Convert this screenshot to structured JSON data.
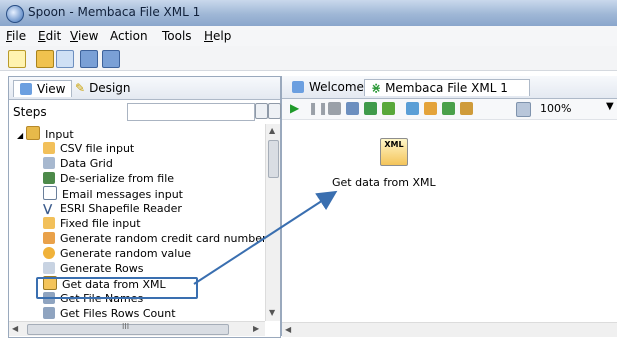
{
  "window": {
    "title": "Spoon - Membaca File XML 1"
  },
  "menu": {
    "items": [
      "File",
      "Edit",
      "View",
      "Action",
      "Tools",
      "Help"
    ],
    "underlined": [
      "F",
      "E",
      "V",
      "",
      "",
      "H"
    ]
  },
  "left_panel": {
    "tabs": {
      "view": "View",
      "design": "Design"
    },
    "steps_label": "Steps",
    "search": {
      "value": "",
      "placeholder": ""
    },
    "tree": {
      "category": "Input",
      "items": [
        "CSV file input",
        "Data Grid",
        "De-serialize from file",
        "Email messages input",
        "ESRI Shapefile Reader",
        "Fixed file input",
        "Generate random credit card numbers",
        "Generate random value",
        "Generate Rows",
        "Get data from XML",
        "Get File Names",
        "Get Files Rows Count"
      ],
      "selected": "Get data from XML"
    },
    "scrollbar": {
      "h_thumb_label": "III"
    }
  },
  "right_panel": {
    "tabs": {
      "welcome": "Welcome!",
      "active": "Membaca File XML 1",
      "close_glyph": "✕"
    },
    "zoom": "100%",
    "canvas": {
      "step_label": "Get data from XML",
      "step_icon_text": "XML"
    }
  },
  "colors": {
    "accent": "#3a6fb0",
    "titlebar": "#9fb7d6",
    "folder": "#e7b94a"
  }
}
